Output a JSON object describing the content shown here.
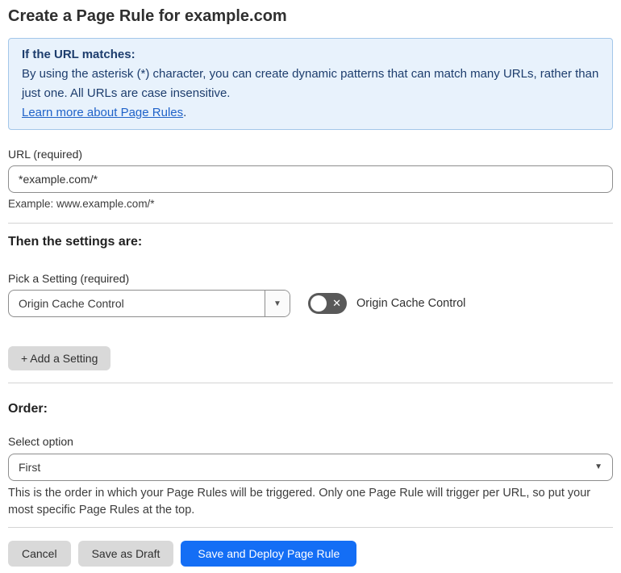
{
  "page": {
    "title": "Create a Page Rule for example.com"
  },
  "info_box": {
    "heading": "If the URL matches:",
    "body": "By using the asterisk (*) character, you can create dynamic patterns that can match many URLs, rather than just one. All URLs are case insensitive.",
    "link_label": "Learn more about Page Rules",
    "link_suffix": "."
  },
  "url_section": {
    "label": "URL (required)",
    "value": "*example.com/*",
    "example": "Example: www.example.com/*"
  },
  "settings_section": {
    "heading": "Then the settings are:",
    "picker_label": "Pick a Setting (required)",
    "picker_value": "Origin Cache Control",
    "toggle_state": "off",
    "toggle_label": "Origin Cache Control",
    "add_setting_label": "+ Add a Setting"
  },
  "order_section": {
    "heading": "Order:",
    "label": "Select option",
    "value": "First",
    "help": "This is the order in which your Page Rules will be triggered. Only one Page Rule will trigger per URL, so put your most specific Page Rules at the top."
  },
  "footer": {
    "cancel_label": "Cancel",
    "save_draft_label": "Save as Draft",
    "save_deploy_label": "Save and Deploy Page Rule"
  },
  "icons": {
    "dropdown_caret": "▼",
    "toggle_off_x": "✕"
  },
  "colors": {
    "info_bg": "#e8f2fc",
    "info_border": "#a3c7e9",
    "info_text": "#1d3d6d",
    "link_blue": "#2063c9",
    "primary_button_blue": "#146ef5",
    "gray_button": "#d9d9d9",
    "toggle_off_gray": "#595959"
  }
}
